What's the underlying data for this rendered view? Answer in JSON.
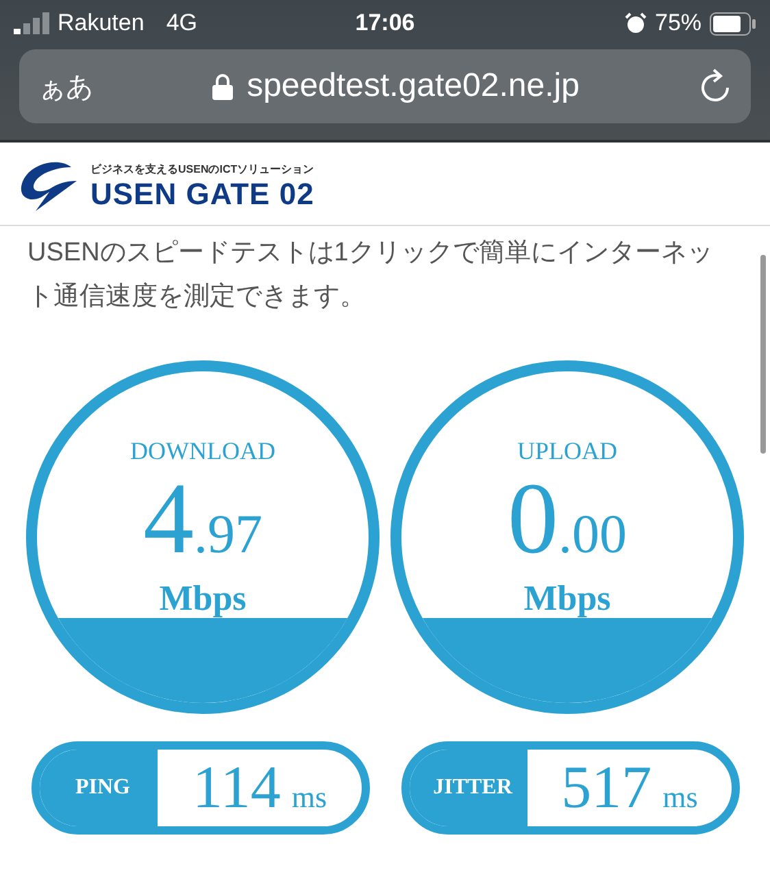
{
  "status_bar": {
    "carrier": "Rakuten",
    "network": "4G",
    "time": "17:06",
    "battery": "75%"
  },
  "address_bar": {
    "text_size": "ぁあ",
    "url": "speedtest.gate02.ne.jp"
  },
  "logo": {
    "tagline": "ビジネスを支えるUSENのICTソリューション",
    "name": "USEN GATE 02"
  },
  "intro": "USENのスピードテストは1クリックで簡単にインターネット通信速度を測定できます。",
  "gauges": [
    {
      "label": "DOWNLOAD",
      "whole": "4",
      "fraction": ".97",
      "unit": "Mbps"
    },
    {
      "label": "UPLOAD",
      "whole": "0",
      "fraction": ".00",
      "unit": "Mbps"
    }
  ],
  "stats": [
    {
      "label": "PING",
      "value": "114",
      "unit": "ms"
    },
    {
      "label": "JITTER",
      "value": "517",
      "unit": "ms"
    }
  ]
}
